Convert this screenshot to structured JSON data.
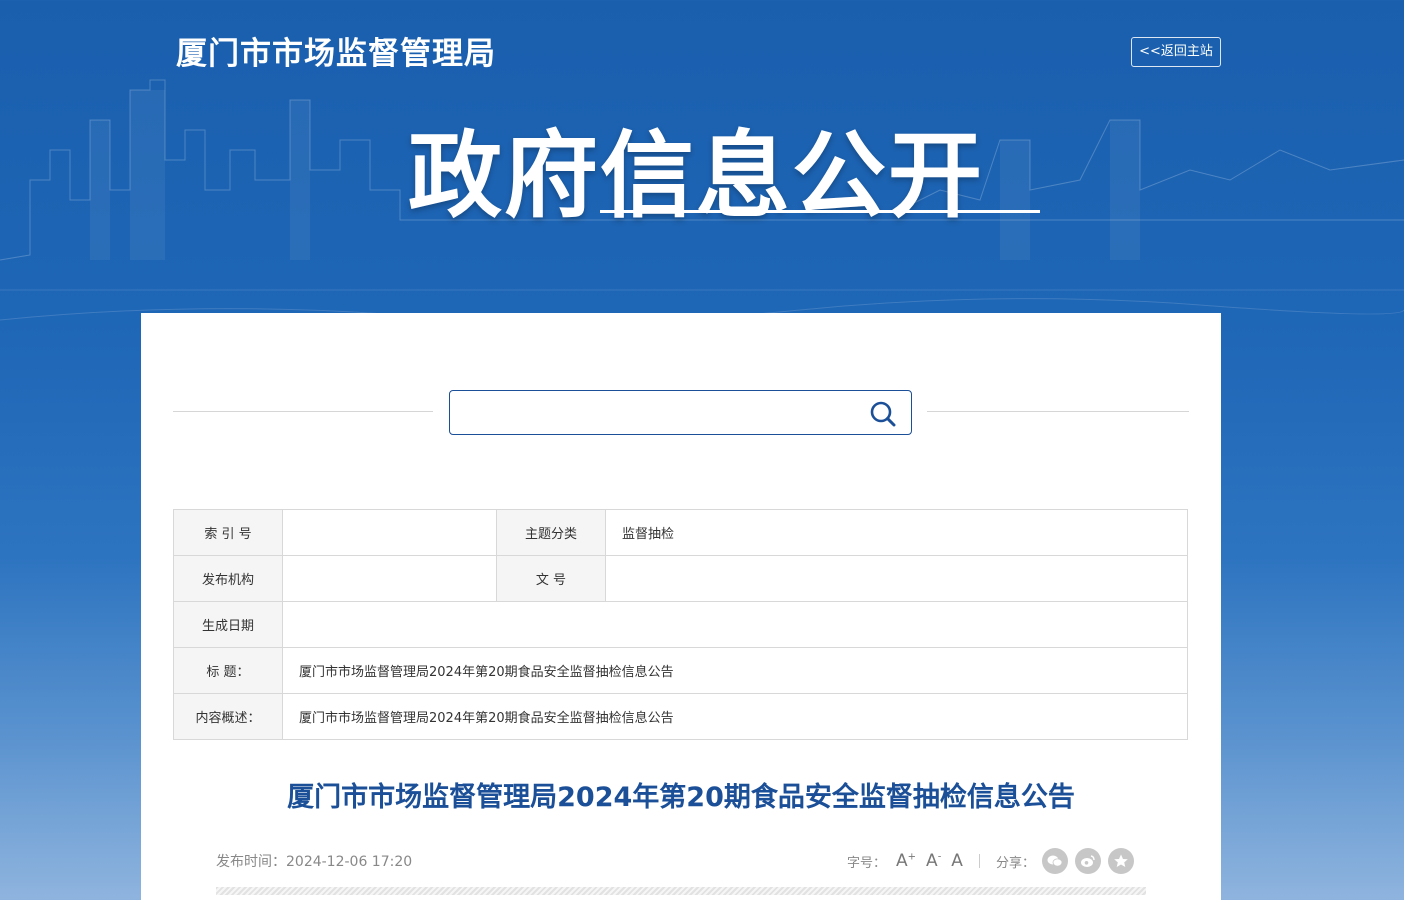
{
  "header": {
    "site_title": "厦门市市场监督管理局",
    "back_label": "<<返回主站",
    "hero_title": "政府信息公开"
  },
  "search": {
    "placeholder": ""
  },
  "meta": {
    "index_label": "索 引 号",
    "index_value": "",
    "topic_label": "主题分类",
    "topic_value": "监督抽检",
    "publisher_label": "发布机构",
    "publisher_value": "",
    "docnum_label": "文 号",
    "docnum_value": "",
    "date_label": "生成日期",
    "date_value": "",
    "title_label": "标 题：",
    "title_value": "厦门市市场监督管理局2024年第20期食品安全监督抽检信息公告",
    "summary_label": "内容概述：",
    "summary_value": "厦门市市场监督管理局2024年第20期食品安全监督抽检信息公告"
  },
  "article": {
    "title": "厦门市市场监督管理局2024年第20期食品安全监督抽检信息公告",
    "publish_time": "发布时间：2024-12-06 17:20"
  },
  "tools": {
    "font_label": "字号：",
    "font_larger": "A",
    "font_larger_mark": "+",
    "font_smaller": "A",
    "font_smaller_mark": "-",
    "font_default": "A",
    "share_label": "分享："
  },
  "colors": {
    "brand_blue": "#1b4f97",
    "background_blue": "#1a5fae"
  },
  "icons": {
    "search": "search-icon",
    "wechat": "wechat-icon",
    "weibo": "weibo-icon",
    "favorite": "star-icon"
  }
}
